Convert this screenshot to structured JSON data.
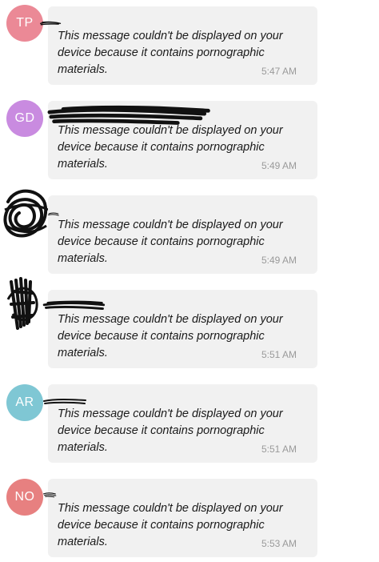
{
  "messages": [
    {
      "avatar_initials": "TP",
      "avatar_color": "#eb8996",
      "avatar_redacted": false,
      "text": "This message couldn't be displayed on your device because it contains pornographic materials.",
      "time": "5:47 AM"
    },
    {
      "avatar_initials": "GD",
      "avatar_color": "#c98be0",
      "avatar_redacted": false,
      "text": "This message couldn't be displayed on your device because it contains pornographic materials.",
      "time": "5:49 AM"
    },
    {
      "avatar_initials": "",
      "avatar_color": "#1a1a1a",
      "avatar_redacted": true,
      "text": "This message couldn't be displayed on your device because it contains pornographic materials.",
      "time": "5:49 AM"
    },
    {
      "avatar_initials": "",
      "avatar_color": "#1a1a1a",
      "avatar_redacted": true,
      "text": "This message couldn't be displayed on your device because it contains pornographic materials.",
      "time": "5:51 AM"
    },
    {
      "avatar_initials": "AR",
      "avatar_color": "#7fc7d4",
      "avatar_redacted": false,
      "text": "This message couldn't be displayed on your device because it contains pornographic materials.",
      "time": "5:51 AM"
    },
    {
      "avatar_initials": "NO",
      "avatar_color": "#e78080",
      "avatar_redacted": false,
      "text": "This message couldn't be displayed on your device because it contains pornographic materials.",
      "time": "5:53 AM"
    }
  ]
}
